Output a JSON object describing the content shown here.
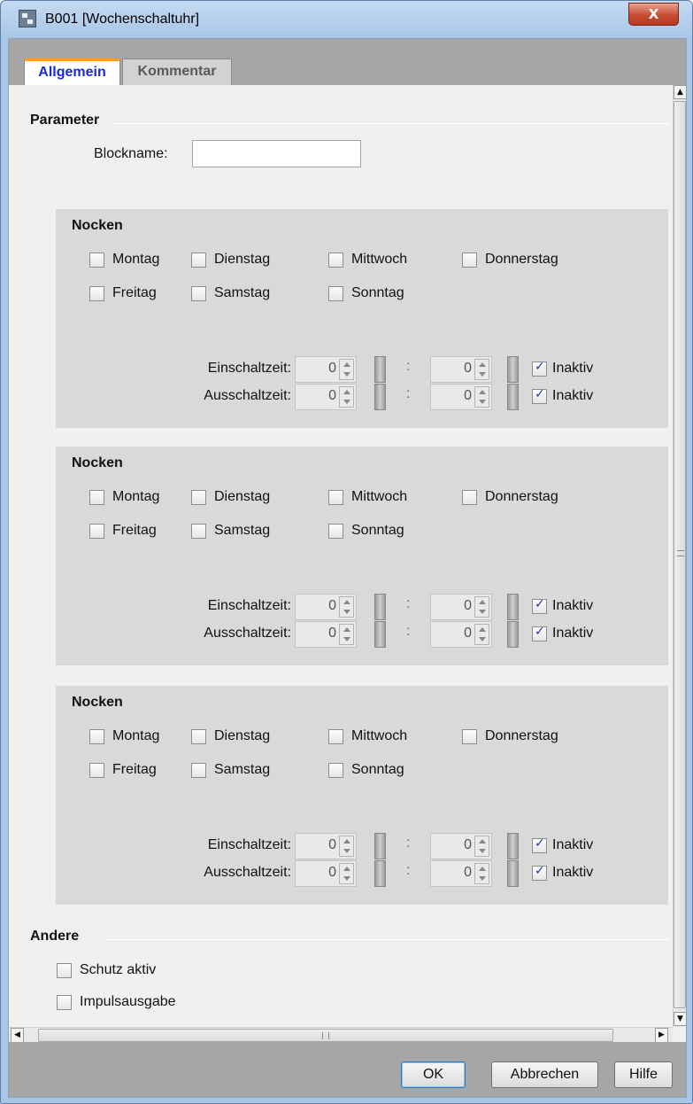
{
  "window": {
    "title": "B001 [Wochenschaltuhr]",
    "close_glyph": "X"
  },
  "tabs": [
    "Allgemein",
    "Kommentar"
  ],
  "parameter": {
    "title": "Parameter",
    "blockname_label": "Blockname:",
    "blockname_value": ""
  },
  "nocken": [
    {
      "title": "Nocken",
      "days": [
        {
          "label": "Montag",
          "checked": false
        },
        {
          "label": "Dienstag",
          "checked": false
        },
        {
          "label": "Mittwoch",
          "checked": false
        },
        {
          "label": "Donnerstag",
          "checked": false
        },
        {
          "label": "Freitag",
          "checked": false
        },
        {
          "label": "Samstag",
          "checked": false
        },
        {
          "label": "Sonntag",
          "checked": false
        }
      ],
      "times": [
        {
          "label": "Einschaltzeit:",
          "hours": "0",
          "separator": ":",
          "minutes": "0",
          "inactive_label": "Inaktiv",
          "inactive": true
        },
        {
          "label": "Ausschaltzeit:",
          "hours": "0",
          "separator": ":",
          "minutes": "0",
          "inactive_label": "Inaktiv",
          "inactive": true
        }
      ]
    },
    {
      "title": "Nocken",
      "days": [
        {
          "label": "Montag",
          "checked": false
        },
        {
          "label": "Dienstag",
          "checked": false
        },
        {
          "label": "Mittwoch",
          "checked": false
        },
        {
          "label": "Donnerstag",
          "checked": false
        },
        {
          "label": "Freitag",
          "checked": false
        },
        {
          "label": "Samstag",
          "checked": false
        },
        {
          "label": "Sonntag",
          "checked": false
        }
      ],
      "times": [
        {
          "label": "Einschaltzeit:",
          "hours": "0",
          "separator": ":",
          "minutes": "0",
          "inactive_label": "Inaktiv",
          "inactive": true
        },
        {
          "label": "Ausschaltzeit:",
          "hours": "0",
          "separator": ":",
          "minutes": "0",
          "inactive_label": "Inaktiv",
          "inactive": true
        }
      ]
    },
    {
      "title": "Nocken",
      "days": [
        {
          "label": "Montag",
          "checked": false
        },
        {
          "label": "Dienstag",
          "checked": false
        },
        {
          "label": "Mittwoch",
          "checked": false
        },
        {
          "label": "Donnerstag",
          "checked": false
        },
        {
          "label": "Freitag",
          "checked": false
        },
        {
          "label": "Samstag",
          "checked": false
        },
        {
          "label": "Sonntag",
          "checked": false
        }
      ],
      "times": [
        {
          "label": "Einschaltzeit:",
          "hours": "0",
          "separator": ":",
          "minutes": "0",
          "inactive_label": "Inaktiv",
          "inactive": true
        },
        {
          "label": "Ausschaltzeit:",
          "hours": "0",
          "separator": ":",
          "minutes": "0",
          "inactive_label": "Inaktiv",
          "inactive": true
        }
      ]
    }
  ],
  "andere": {
    "title": "Andere",
    "options": [
      {
        "label": "Schutz aktiv",
        "checked": false
      },
      {
        "label": "Impulsausgabe",
        "checked": false
      }
    ]
  },
  "buttons": {
    "ok": "OK",
    "cancel": "Abbrechen",
    "help": "Hilfe"
  }
}
